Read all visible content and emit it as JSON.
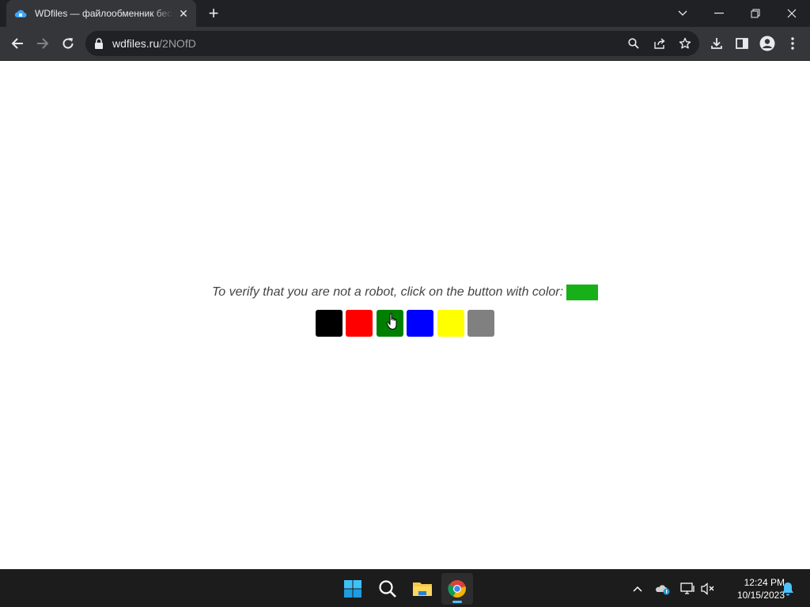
{
  "browser": {
    "tab": {
      "title": "WDfiles — файлообменник бесплатно",
      "favicon": "cloud-favicon-icon"
    },
    "address": {
      "host": "wdfiles.ru",
      "path": "/2NOfD"
    },
    "icons": {
      "back": "arrow-left-icon",
      "forward": "arrow-right-icon",
      "reload": "reload-icon",
      "lock": "lock-icon",
      "zoom": "search-icon",
      "share": "share-icon",
      "bookmark": "star-icon",
      "download": "download-icon",
      "sidepanel": "side-panel-icon",
      "profile": "profile-icon",
      "menu": "kebab-menu-icon"
    }
  },
  "captcha": {
    "instruction": "To verify that you are not a robot, click on the button with color:",
    "target_color": "#18b018",
    "buttons": [
      {
        "name": "black",
        "color": "#000000"
      },
      {
        "name": "red",
        "color": "#ff0000"
      },
      {
        "name": "green",
        "color": "#008000"
      },
      {
        "name": "blue",
        "color": "#0000ff"
      },
      {
        "name": "yellow",
        "color": "#ffff00"
      },
      {
        "name": "gray",
        "color": "#808080"
      }
    ]
  },
  "taskbar": {
    "apps": [
      "windows-start-icon",
      "search-icon",
      "file-explorer-icon",
      "chrome-icon"
    ],
    "tray": [
      "chevron-up-icon",
      "onedrive-icon",
      "network-icon",
      "volume-muted-icon",
      "notification-bell-icon"
    ],
    "clock": {
      "time": "12:24 PM",
      "date": "10/15/2023"
    }
  }
}
